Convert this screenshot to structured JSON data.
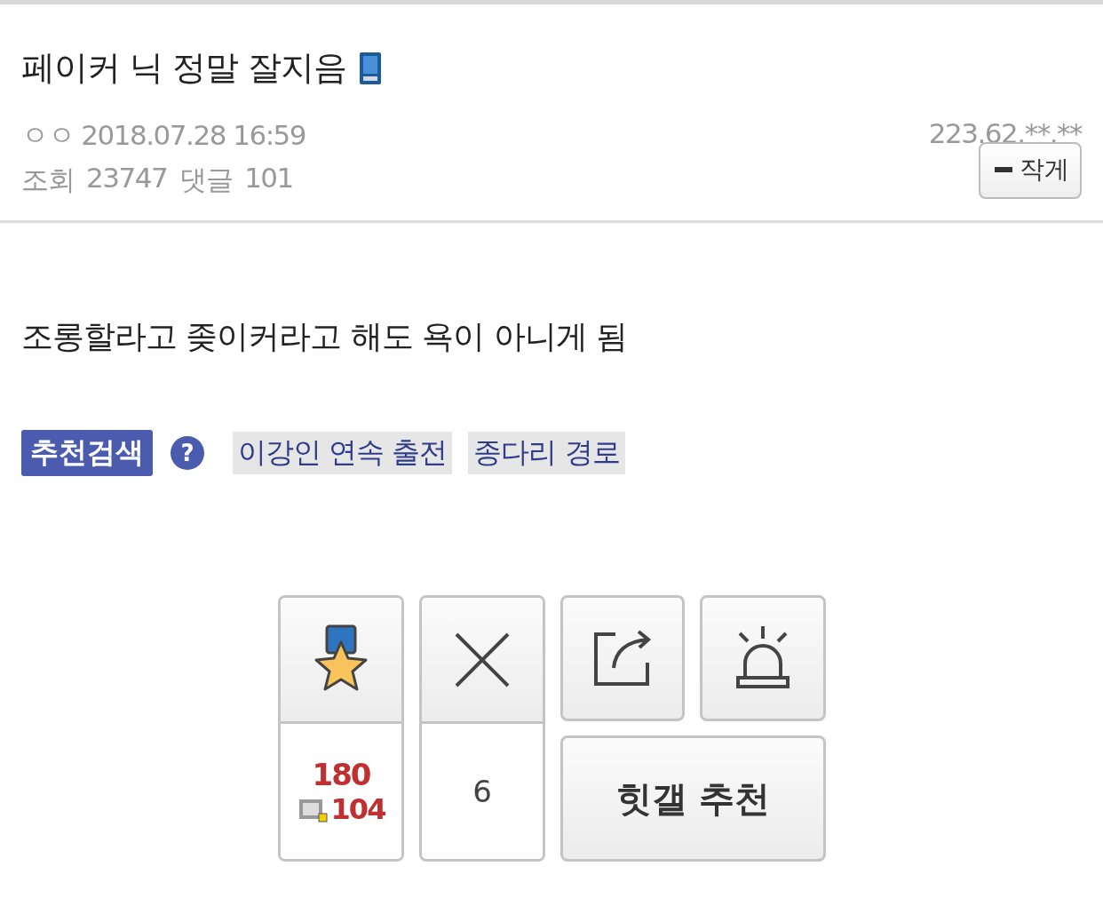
{
  "post": {
    "title": "페이커 닉 정말 잘지음",
    "author": "ㅇㅇ",
    "datetime": "2018.07.28 16:59",
    "ip": "223.62.**.**",
    "views_label": "조회",
    "views": "23747",
    "comments_label": "댓글",
    "comments": "101",
    "shrink_button": "작게"
  },
  "body": "조롱할라고 좆이커라고 해도 욕이 아니게 됨",
  "recommend_search": {
    "label": "추천검색",
    "help": "?",
    "tags": [
      "이강인 연속 출전",
      "종다리 경로"
    ]
  },
  "actions": {
    "recommend_count": "180",
    "fixed_recommend_count": "104",
    "downvote_count": "6",
    "hit_button": "힛갤 추천"
  }
}
